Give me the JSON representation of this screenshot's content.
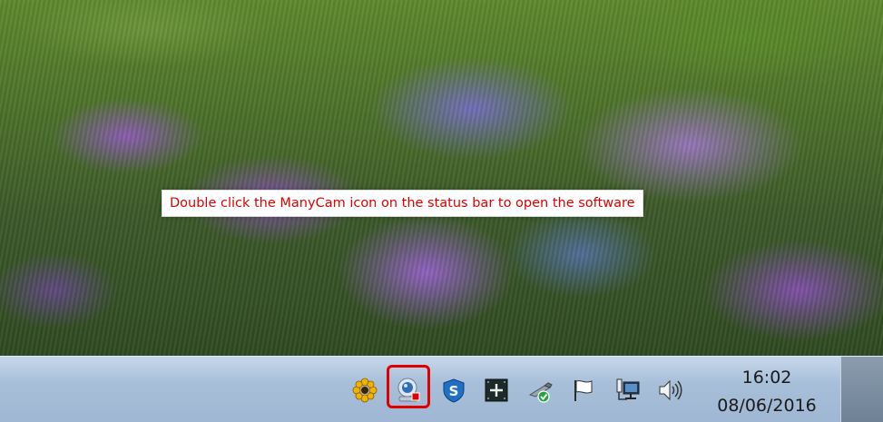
{
  "instruction_text": "Double click the ManyCam icon on the status bar to open the software",
  "tray": {
    "icons": [
      "sun-icon",
      "manycam-webcam-icon",
      "security-s-icon",
      "safely-remove-icon",
      "usb-device-icon",
      "action-center-flag-icon",
      "network-icon",
      "volume-icon"
    ]
  },
  "clock": {
    "time": "16:02",
    "date": "08/06/2016"
  },
  "colors": {
    "annotation_red": "#e00000",
    "taskbar": "#a8bfd9"
  }
}
